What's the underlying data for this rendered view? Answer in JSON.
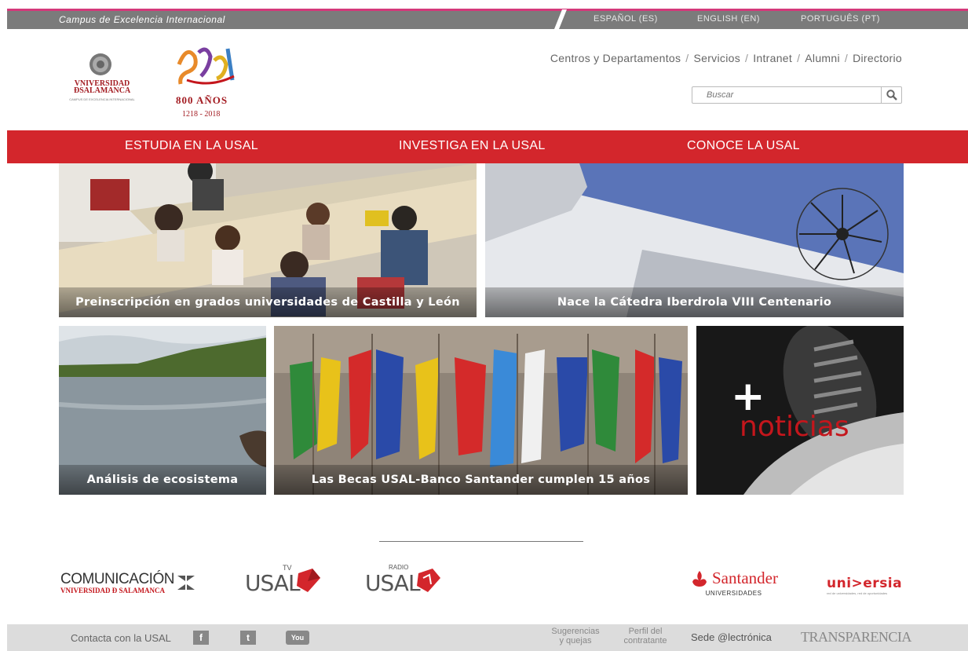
{
  "topbar": {
    "campus": "Campus de Excelencia Internacional",
    "languages": [
      "ESPAÑOL (ES)",
      "ENGLISH (EN)",
      "PORTUGUÊS (PT)"
    ]
  },
  "logos": {
    "usal_line1": "VNIVERSIDAD",
    "usal_line2": "ÐSALAMANCA",
    "usal_line3": "CAMPUS DE EXCELENCIA INTERNACIONAL",
    "anniv_title": "800 AÑOS",
    "anniv_years": "1218 - 2018"
  },
  "header_nav": [
    "Centros y Departamentos",
    "Servicios",
    "Intranet",
    "Alumni",
    "Directorio"
  ],
  "search": {
    "placeholder": "Buscar"
  },
  "main_nav": [
    "ESTUDIA EN LA USAL",
    "INVESTIGA EN LA USAL",
    "CONOCE LA USAL"
  ],
  "tiles": [
    "Preinscripción en grados universidades de Castilla y León",
    "Nace la Cátedra Iberdrola VIII Centenario",
    "Análisis de ecosistema",
    "Las Becas USAL-Banco Santander cumplen 15 años"
  ],
  "more_news": {
    "plus": "+",
    "label": "noticias"
  },
  "partners": {
    "comunicacion": "COMUNICACIÓN",
    "comunicacion_sub": "VNIVERSIDAD Ð SALAMANCA",
    "usaltv": "USAL",
    "usaltv_tag": "TV",
    "radio": "USAL",
    "radio_tag": "RADIO",
    "santander": "Santander",
    "santander_sub": "UNIVERSIDADES",
    "universia": "uni>ersia",
    "universia_sub": "red de universidades, red de oportunidades"
  },
  "footer": {
    "contacta": "Contacta con la USAL",
    "facebook": "f",
    "twitter": "t",
    "youtube": "You",
    "sugerencias_1": "Sugerencias",
    "sugerencias_2": "y quejas",
    "perfil_1": "Perfil del",
    "perfil_2": "contratante",
    "sede": "Sede @lectrónica",
    "transparencia": "TRANSPARENCIA"
  },
  "colors": {
    "accent_red": "#d3262c",
    "pink_line": "#d4397a",
    "topbar_gray": "#7b7b7b"
  }
}
